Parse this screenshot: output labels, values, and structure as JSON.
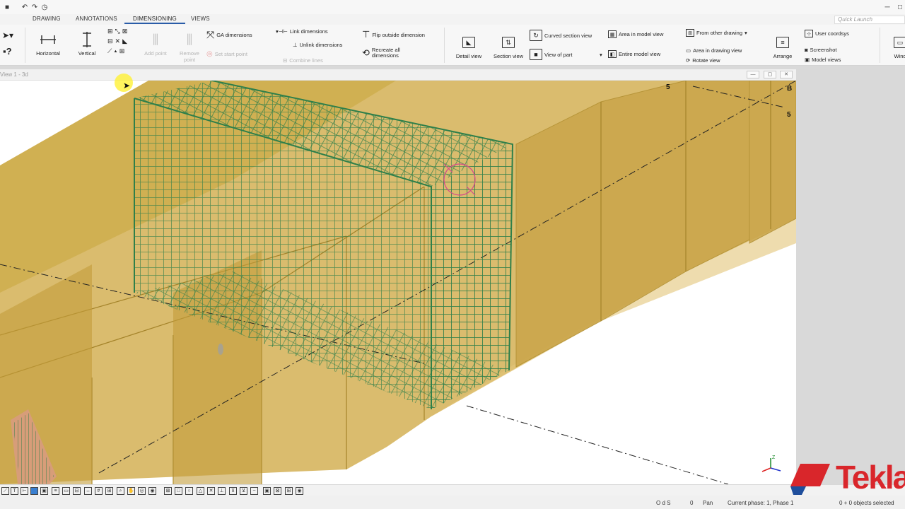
{
  "titlebar": {
    "minimize_glyph": "─",
    "maximize_glyph": "□",
    "quick_launch_placeholder": "Quick Launch"
  },
  "tabs": [
    {
      "label": "DRAWING"
    },
    {
      "label": "ANNOTATIONS"
    },
    {
      "label": "DIMENSIONING"
    },
    {
      "label": "VIEWS"
    }
  ],
  "ribbon": {
    "horizontal": "Horizontal",
    "vertical": "Vertical",
    "add_point": "Add point",
    "remove_point": "Remove point",
    "ga_dimensions": "GA dimensions",
    "set_start_point": "Set start point",
    "link_dimensions": "Link dimensions",
    "unlink_dimensions": "Unlink dimensions",
    "combine_lines": "Combine lines",
    "flip_outside_dimension": "Flip outside dimension",
    "recreate_all_dimensions": "Recreate all dimensions",
    "detail_view": "Detail view",
    "section_view": "Section view",
    "curved_section_view": "Curved section view",
    "view_of_part": "View of part",
    "area_in_model_view": "Area in model view",
    "entire_model_view": "Entire model view",
    "from_other_drawing": "From other drawing",
    "area_in_drawing_view": "Area in drawing view",
    "rotate_view": "Rotate view",
    "arrange": "Arrange",
    "user_coordsys": "User coordsys",
    "screenshot": "Screenshot",
    "model_views": "Model views",
    "windows_partial": "Wind"
  },
  "view": {
    "title": "View 1 - 3d",
    "grid_labels": {
      "top_left_5": "5",
      "top_right_b": "B",
      "right_5": "5"
    },
    "axis_z": "Z"
  },
  "status": {
    "coords": "O d S",
    "zero": "0",
    "mode": "Pan",
    "phase": "Current phase: 1, Phase 1",
    "selection": "0 + 0 objects selected"
  },
  "brand": {
    "name": "Tekla"
  },
  "colors": {
    "accent": "#2a5ca8",
    "concrete": "#c9a63d",
    "rebar": "#2e7f4a",
    "brand_red": "#d9262b"
  }
}
